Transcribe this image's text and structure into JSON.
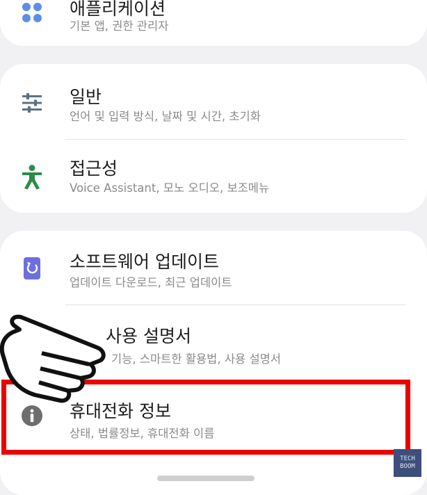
{
  "sections": {
    "apps": {
      "title": "애플리케이션",
      "subtitle": "기본 앱, 권한 관리자"
    },
    "general": {
      "title": "일반",
      "subtitle": "언어 및 입력 방식, 날짜 및 시간, 초기화"
    },
    "accessibility": {
      "title": "접근성",
      "subtitle": "Voice Assistant, 모노 오디오, 보조메뉴"
    },
    "software_update": {
      "title": "소프트웨어 업데이트",
      "subtitle": "업데이트 다운로드, 최근 업데이트"
    },
    "user_manual": {
      "title": "사용 설명서",
      "subtitle": "기능, 스마트한 활용법, 사용 설명서"
    },
    "about_phone": {
      "title": "휴대전화 정보",
      "subtitle": "상태, 법률정보, 휴대전화 이름"
    }
  },
  "watermark": {
    "line1": "TECH",
    "line2": "BOOM"
  },
  "colors": {
    "apps_icon": "#5b8fe6",
    "general_icon": "#5b7088",
    "accessibility_icon": "#2f8a4a",
    "update_icon": "#6c6fe0",
    "info_icon": "#6e6e6e",
    "highlight": "#ec0000"
  },
  "icons": {
    "apps": "apps-grid-icon",
    "general": "sliders-icon",
    "accessibility": "accessibility-person-icon",
    "software_update": "update-icon",
    "about_phone": "info-icon",
    "pointer": "pointing-hand-icon"
  }
}
